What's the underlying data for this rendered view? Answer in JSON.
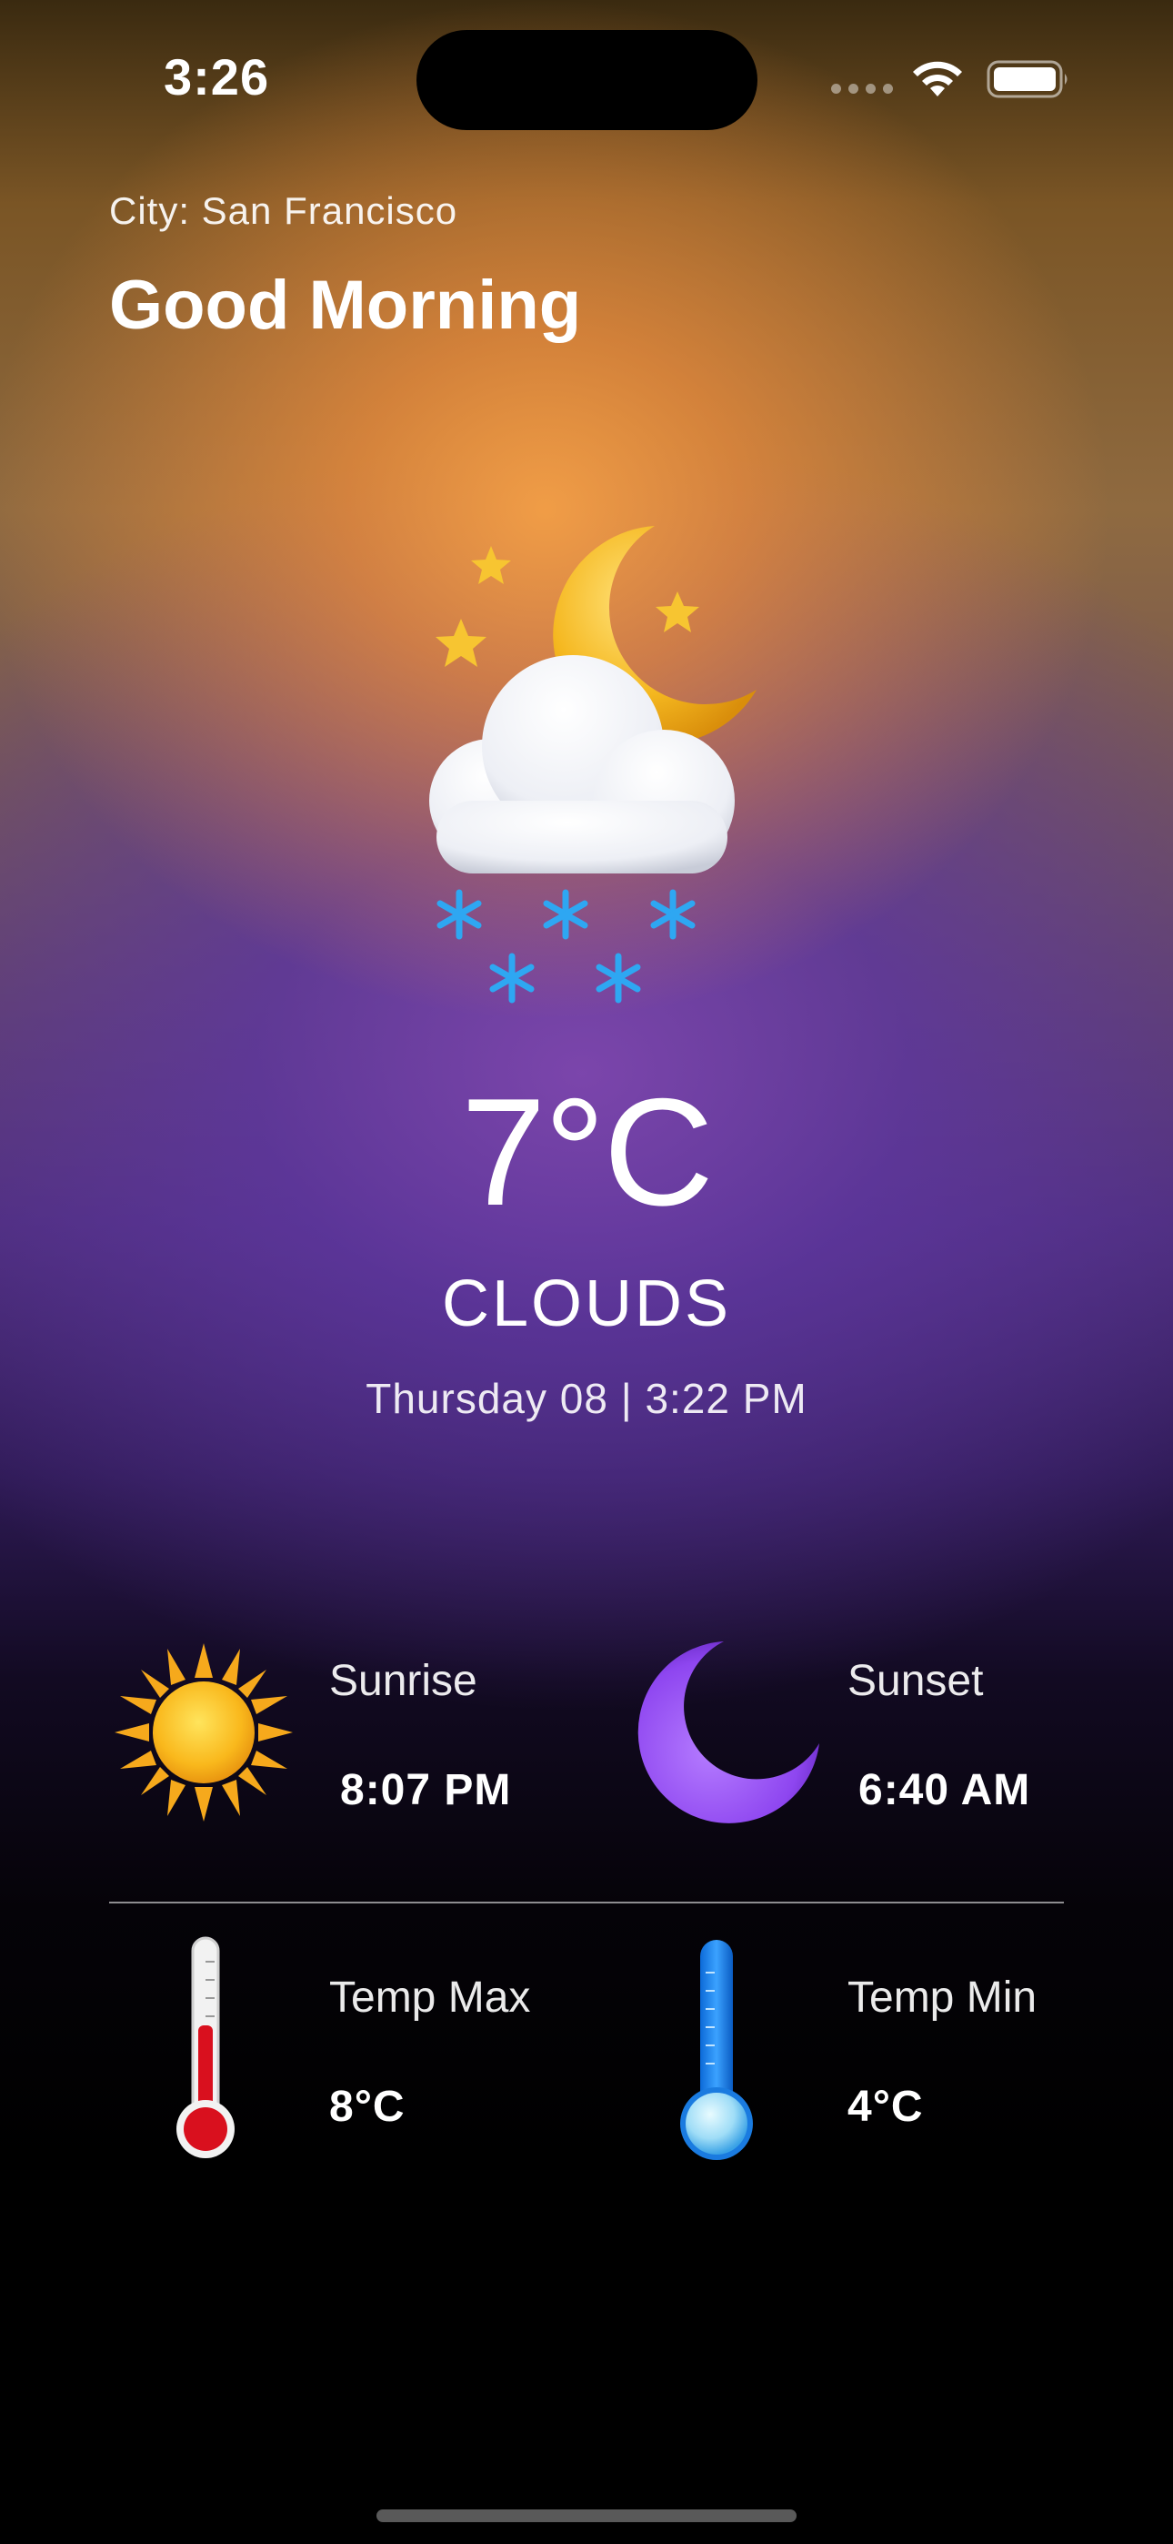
{
  "status_bar": {
    "time": "3:26"
  },
  "header": {
    "city": "City: San Francisco",
    "greeting": "Good Morning"
  },
  "weather": {
    "icon": "night-cloud-snow-icon",
    "temperature": "7°C",
    "condition": "CLOUDS",
    "date_time": "Thursday 08 | 3:22 PM"
  },
  "stats": {
    "sunrise": {
      "label": "Sunrise",
      "value": "8:07 PM",
      "icon": "sun-icon"
    },
    "sunset": {
      "label": "Sunset",
      "value": "6:40 AM",
      "icon": "moon-icon"
    },
    "temp_max": {
      "label": "Temp Max",
      "value": "8°C",
      "icon": "thermometer-hot-icon"
    },
    "temp_min": {
      "label": "Temp Min",
      "value": "4°C",
      "icon": "thermometer-cold-icon"
    }
  },
  "colors": {
    "accent_orange": "#F6A046",
    "accent_purple": "#6B3FA8",
    "background": "#000000"
  }
}
